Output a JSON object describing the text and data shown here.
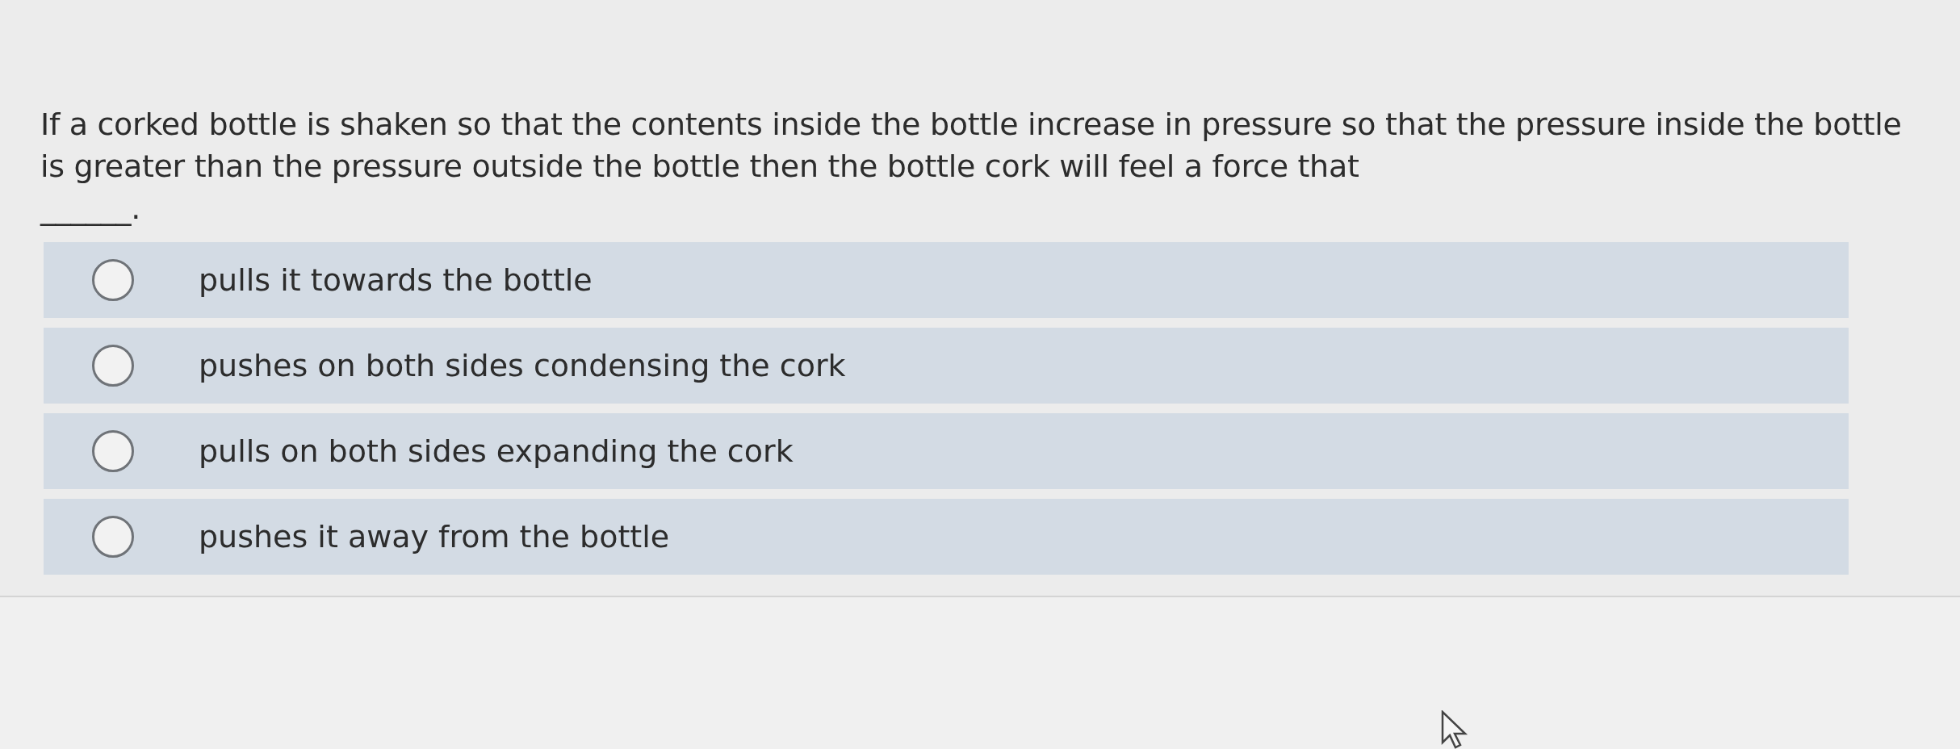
{
  "question": {
    "text": "If a corked bottle is shaken so that the contents inside the bottle increase in pressure so that the pressure inside the bottle is greater than the pressure outside the bottle then the bottle cork will feel a force that",
    "blank": "______."
  },
  "options": [
    {
      "label": "pulls it towards the bottle",
      "selected": false
    },
    {
      "label": "pushes on both sides condensing the cork",
      "selected": false
    },
    {
      "label": "pulls on both sides expanding the cork",
      "selected": false
    },
    {
      "label": "pushes it away from the bottle",
      "selected": false
    }
  ]
}
